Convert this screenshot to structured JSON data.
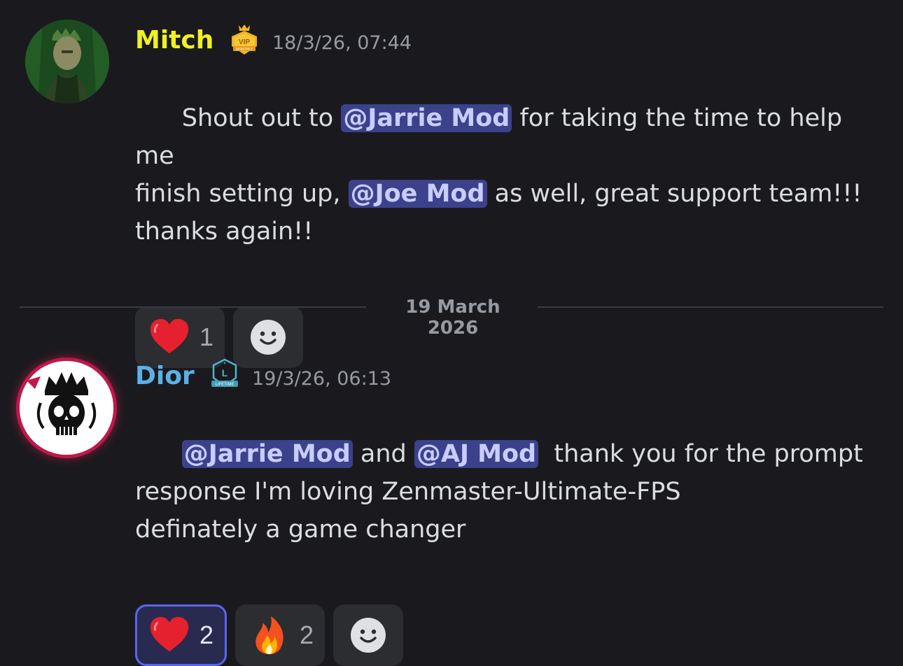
{
  "messages": [
    {
      "username": "Mitch",
      "badge": "vip-monthly-badge",
      "badge_lines": [
        "VIP",
        "MONTHLY"
      ],
      "timestamp": "18/3/26, 07:44",
      "segments": [
        {
          "type": "text",
          "text": "Shout out to "
        },
        {
          "type": "mention",
          "text": "@Jarrie Mod"
        },
        {
          "type": "text",
          "text": " for taking the time to help me\nfinish setting up, "
        },
        {
          "type": "mention",
          "text": "@Joe Mod"
        },
        {
          "type": "text",
          "text": " as well, great support team!!!\nthanks again!!"
        }
      ],
      "reactions": [
        {
          "emoji": "red-heart",
          "count": "1",
          "active": false
        }
      ]
    },
    {
      "username": "Dior",
      "badge": "lifetime-badge",
      "badge_lines": [
        "L",
        "LIFETIME"
      ],
      "timestamp": "19/3/26, 06:13",
      "segments": [
        {
          "type": "mention",
          "text": "@Jarrie Mod"
        },
        {
          "type": "text",
          "text": " and "
        },
        {
          "type": "mention",
          "text": "@AJ Mod"
        },
        {
          "type": "text",
          "text": "  thank you for the prompt\nresponse I'm loving Zenmaster-Ultimate-FPS\ndefinately a game changer"
        }
      ],
      "reactions": [
        {
          "emoji": "red-heart",
          "count": "2",
          "active": true
        },
        {
          "emoji": "fire",
          "count": "2",
          "active": false
        }
      ]
    }
  ],
  "date_divider": "19 March 2026",
  "colors": {
    "background": "#1a1a1e",
    "mitch_name": "#f0f121",
    "dior_name": "#5cb0e8",
    "mention_bg": "#3c418c",
    "reaction_active_border": "#5865f2"
  }
}
